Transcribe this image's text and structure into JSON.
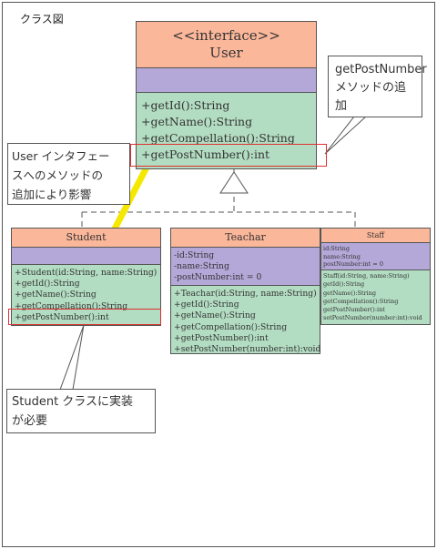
{
  "diagram_title": "クラス図",
  "interface_class": {
    "stereotype": "<<interface>>",
    "name": "User",
    "operations": [
      "+getId():String",
      "+getName():String",
      "+getCompellation():String",
      "+getPostNumber():int"
    ]
  },
  "student_class": {
    "name": "Student",
    "attributes": [],
    "operations": [
      "+Student(id:String, name:String)",
      "+getId():String",
      "+getName():String",
      "+getCompellation():String",
      "+getPostNumber():int"
    ]
  },
  "teachar_class": {
    "name": "Teachar",
    "attributes": [
      "-id:String",
      "-name:String",
      "-postNumber:int = 0"
    ],
    "operations": [
      "+Teachar(id:String, name:String)",
      "+getId():String",
      "+getName():String",
      "+getCompellation():String",
      "+getPostNumber():int",
      "+setPostNumber(number:int):void"
    ]
  },
  "staff_class": {
    "name": "Staff",
    "attributes": [
      "id:String",
      "name:String",
      "postNumber:int = 0"
    ],
    "operations": [
      "Staff(id:String, name:String)",
      "getId():String",
      "getName():String",
      "getCompellation():String",
      "getPostNumber():int",
      "setPostNumber(number:int):void"
    ]
  },
  "callouts": {
    "add_method": [
      "getPostNumber",
      "メソッドの追",
      "加"
    ],
    "impact": [
      "User インタフェー",
      "スへのメソッドの",
      "追加により影響"
    ],
    "student_impl": [
      "Student クラスに実装",
      "が必要"
    ]
  },
  "colors": {
    "header": "#fbb79a",
    "attributes": "#b4a8d9",
    "operations": "#b3ddc2",
    "highlight": "#e03030",
    "arrow": "#f5e800"
  }
}
